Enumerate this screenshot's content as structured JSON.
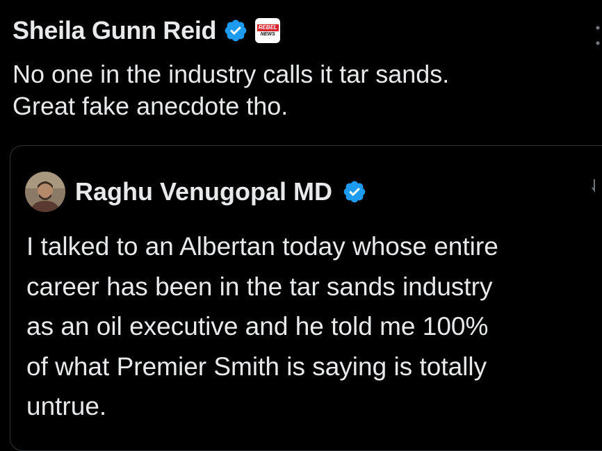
{
  "tweet": {
    "author_name": "Sheila Gunn Reid",
    "verified_icon": "verified-badge-icon",
    "affiliate_badge": {
      "line1": "REBEL",
      "line2": "NEWS"
    },
    "text_lines": [
      "No one in the industry calls it tar sands.",
      "Great fake anecdote tho."
    ]
  },
  "quote": {
    "author_name": "Raghu Venugopal MD",
    "verified_icon": "verified-badge-icon",
    "text_lines": [
      "I talked to an Albertan today whose entire",
      "career has been in the tar sands industry",
      "as an oil executive and he told me 100%",
      "of what Premier Smith is saying is totally",
      "untrue."
    ]
  },
  "colors": {
    "background": "#000000",
    "text": "#e7e9ea",
    "verified_blue": "#1d9bf0",
    "card_border": "#2f3336",
    "rebel_red": "#d9202a"
  }
}
